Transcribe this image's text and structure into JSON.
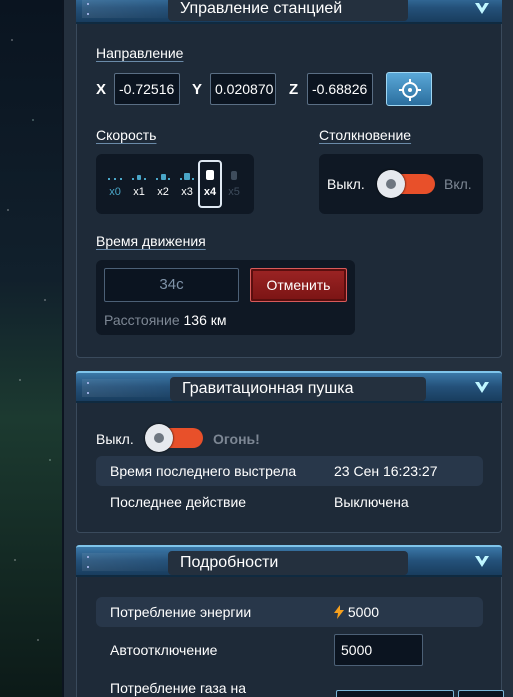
{
  "station": {
    "title": "Управление станцией",
    "direction_label": "Направление",
    "x_label": "X",
    "x_value": "-0.72516",
    "y_label": "Y",
    "y_value": "0.020870",
    "z_label": "Z",
    "z_value": "-0.68826",
    "speed_label": "Скорость",
    "speed_options": [
      "x0",
      "x1",
      "x2",
      "x3",
      "x4",
      "x5"
    ],
    "speed_selected": "x4",
    "collision_label": "Столкновение",
    "collision_off": "Выкл.",
    "collision_on": "Вкл.",
    "move_time_label": "Время движения",
    "move_time_value": "34с",
    "cancel_label": "Отменить",
    "distance_label": "Расстояние",
    "distance_value": "136 км"
  },
  "gravity": {
    "title": "Гравитационная пушка",
    "off_label": "Выкл.",
    "fire_label": "Огонь!",
    "last_shot_label": "Время последнего выстрела",
    "last_shot_value": "23 Сен 16:23:27",
    "last_action_label": "Последнее действие",
    "last_action_value": "Выключена"
  },
  "details": {
    "title": "Подробности",
    "energy_label": "Потребление энергии",
    "energy_value": "5000",
    "auto_off_label": "Автоотключение",
    "auto_off_value": "5000",
    "gas_label": "Потребление газа на"
  },
  "colors": {
    "accent": "#3b78a8",
    "danger": "#e8502a",
    "energy": "#f6d21e"
  }
}
